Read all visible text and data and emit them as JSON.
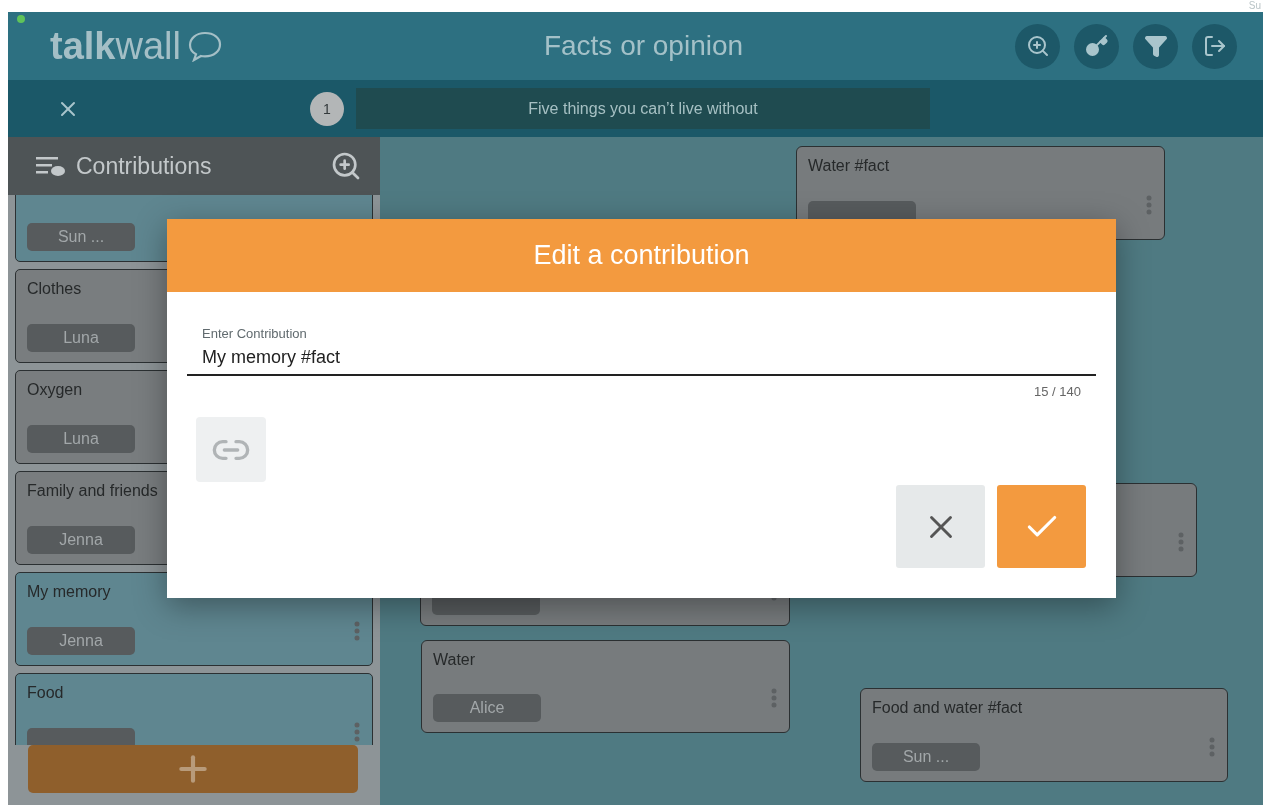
{
  "corner_text": "Su",
  "header": {
    "logo_bold": "talk",
    "logo_light": "wall",
    "title": "Facts or opinion"
  },
  "question_bar": {
    "number": "1",
    "question": "Five things you can’t live without"
  },
  "sidebar": {
    "title": "Contributions",
    "cards": [
      {
        "author": "Sun ...",
        "color": "#5f8690",
        "menu": false
      },
      {
        "text": "Clothes",
        "author": "Luna",
        "color": "#797d7f",
        "menu": false
      },
      {
        "text": "Oxygen",
        "author": "Luna",
        "color": "#797d7f",
        "menu": false
      },
      {
        "text": "Family and friends",
        "author": "Jenna",
        "color": "#797d7f",
        "menu": false
      },
      {
        "text": "My memory",
        "author": "Jenna",
        "color": "#5f8690",
        "menu": true
      },
      {
        "text": "Food",
        "tag": true,
        "color": "#5f8690",
        "menu": true
      }
    ]
  },
  "wall": {
    "notes": [
      {
        "text": "Water #fact",
        "tag": true,
        "menu": true
      },
      {
        "tag": true,
        "menu": true
      },
      {
        "menu": true
      },
      {
        "text": "Water",
        "author": "Alice",
        "menu": true
      },
      {
        "text": "Food and water #fact",
        "author": "Sun ...",
        "menu": true
      }
    ]
  },
  "dialog": {
    "title": "Edit a contribution",
    "field_label": "Enter Contribution",
    "field_value": "My memory #fact",
    "counter": "15 / 140"
  }
}
